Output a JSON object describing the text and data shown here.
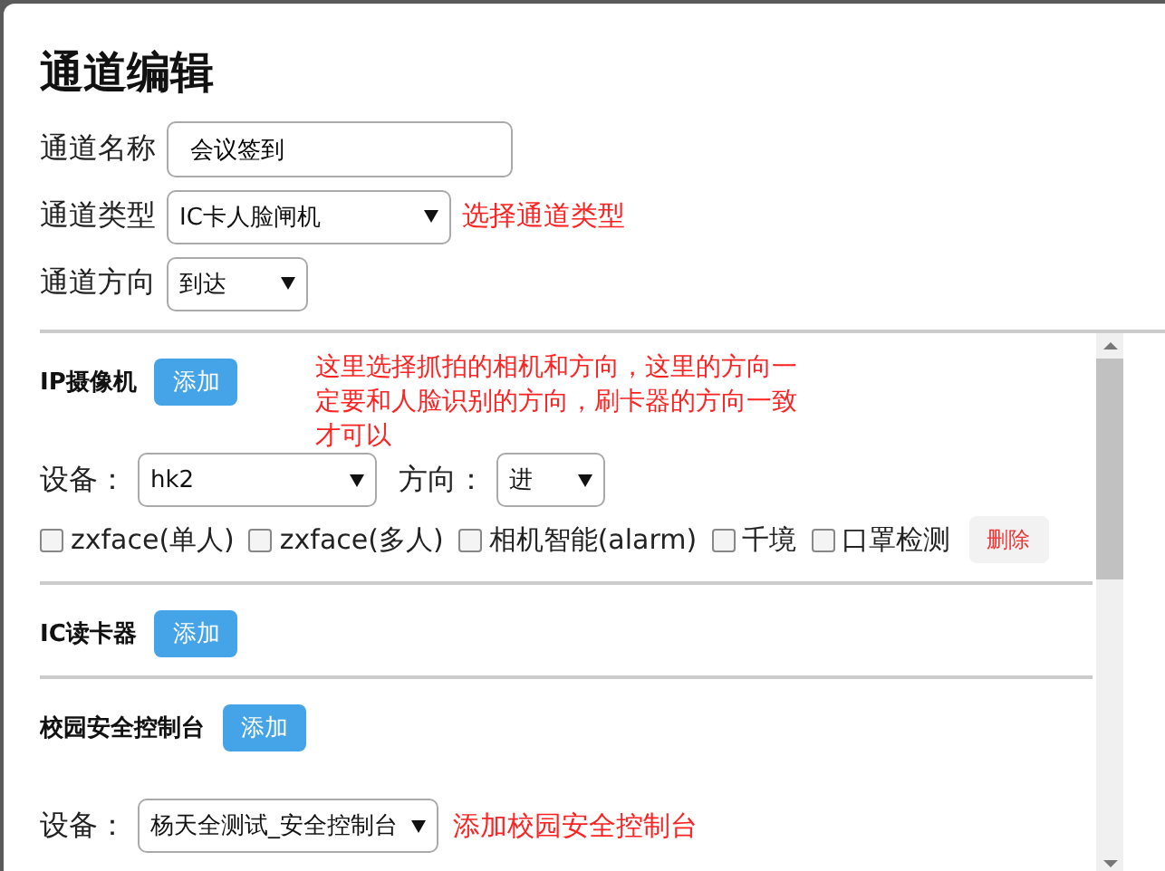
{
  "title": "通道编辑",
  "fields": [
    {
      "label": "通道名称",
      "kind": "text",
      "value": "会议签到"
    },
    {
      "label": "通道类型",
      "kind": "select",
      "value": "IC卡人脸闸机",
      "hint": "选择通道类型"
    },
    {
      "label": "通道方向",
      "kind": "select",
      "value": "到达"
    }
  ],
  "sections": [
    {
      "title": "IP摄像机",
      "add_button": "添加",
      "note": "这里选择抓拍的相机和方向，这里的方向一定要和人脸识别的方向，刷卡器的方向一致才可以",
      "devices": [
        {
          "device_label": "设备：",
          "device": "hk2",
          "direction_label": "方向：",
          "direction": "进",
          "options": [
            {
              "label": "zxface(单人)",
              "checked": false
            },
            {
              "label": "zxface(多人)",
              "checked": false
            },
            {
              "label": "相机智能(alarm)",
              "checked": false
            },
            {
              "label": "千境",
              "checked": false
            },
            {
              "label": "口罩检测",
              "checked": false
            }
          ],
          "delete_button": "删除"
        }
      ]
    },
    {
      "title": "IC读卡器",
      "add_button": "添加"
    },
    {
      "title": "校园安全控制台",
      "add_button": "添加",
      "devices": [
        {
          "device_label": "设备：",
          "device": "杨天全测试_安全控制台",
          "hint": "添加校园安全控制台"
        }
      ]
    }
  ]
}
